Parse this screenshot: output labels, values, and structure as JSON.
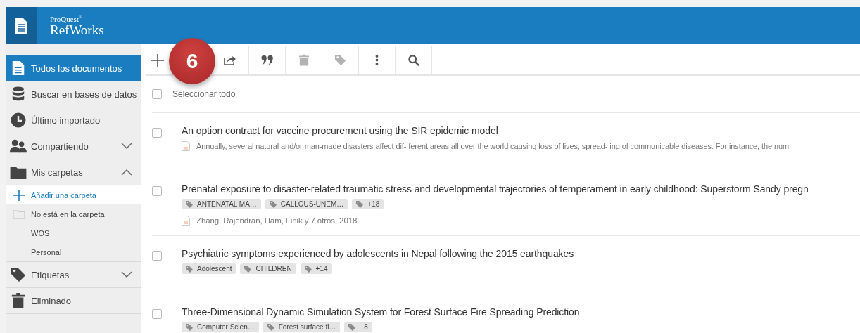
{
  "app": {
    "brand_small": "ProQuest",
    "brand_mark": "®",
    "brand": "RefWorks"
  },
  "callout_badge": "6",
  "sidebar": {
    "items": [
      {
        "label": "Todos los documentos",
        "selected": true
      },
      {
        "label": "Buscar en bases de datos",
        "selected": false
      },
      {
        "label": "Último importado",
        "selected": false
      },
      {
        "label": "Compartiendo",
        "selected": false,
        "expanded": false
      },
      {
        "label": "Mis carpetas",
        "selected": false,
        "expanded": true,
        "children": [
          {
            "label": "Añadir una carpeta",
            "kind": "add",
            "selected": true
          },
          {
            "label": "No está en la carpeta",
            "kind": "folder",
            "selected": false
          },
          {
            "label": "WOS",
            "kind": "plain",
            "selected": false
          },
          {
            "label": "Personal",
            "kind": "plain",
            "selected": false
          }
        ]
      },
      {
        "label": "Etiquetas",
        "selected": false,
        "expanded": false
      },
      {
        "label": "Eliminado",
        "selected": false
      }
    ]
  },
  "toolbar": [
    {
      "disabled": false
    },
    {
      "disabled": false
    },
    {
      "disabled": false
    },
    {
      "disabled": true
    },
    {
      "disabled": true
    },
    {
      "disabled": false
    },
    {
      "disabled": false
    }
  ],
  "select_all": {
    "label": "Seleccionar todo",
    "checked": false
  },
  "records": [
    {
      "title": "An option contract for vaccine procurement using the SIR epidemic model",
      "checked": false,
      "abstract": "Annually, several natural and/or man-made disasters affect dif- ferent areas all over the world causing loss of lives, spread- ing of communicable diseases. For instance, the num"
    },
    {
      "title": "Prenatal exposure to disaster-related traumatic stress and developmental trajectories of temperament in early childhood: Superstorm Sandy pregn",
      "checked": false,
      "tags": [
        "ANTENATAL MA…",
        "CALLOUS-UNEM…",
        "+18"
      ],
      "authors": "Zhang, Rajendran, Ham, Finik y 7 otros, 2018"
    },
    {
      "title": "Psychiatric symptoms experienced by adolescents in Nepal following the 2015 earthquakes",
      "checked": false,
      "tags": [
        "Adolescent",
        "CHILDREN",
        "+14"
      ]
    },
    {
      "title": "Three-Dimensional Dynamic Simulation System for Forest Surface Fire Spreading Prediction",
      "checked": false,
      "tags": [
        "Computer Scien…",
        "Forest surface fi…",
        "+8"
      ]
    }
  ]
}
